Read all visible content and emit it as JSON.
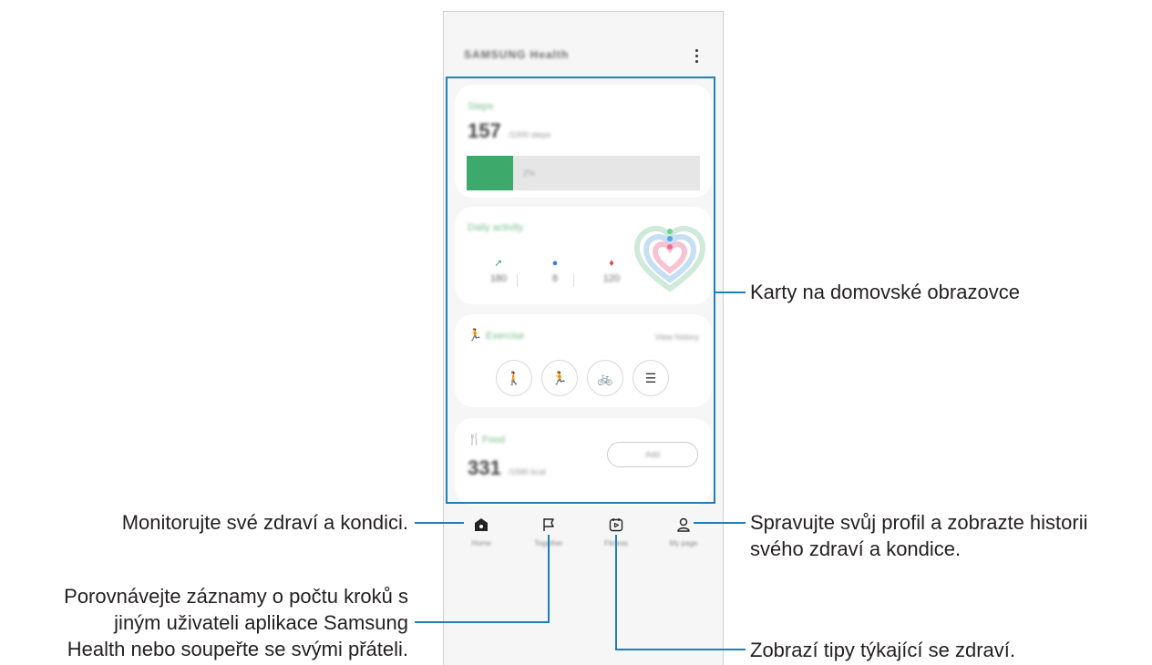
{
  "app": {
    "title": "SAMSUNG Health",
    "menu_icon": "more-vertical-icon"
  },
  "cards": {
    "steps": {
      "label": "Steps",
      "value": "157",
      "goal": "/1000 steps",
      "bar_label": "2%",
      "progress_fraction": 0.2
    },
    "daily_activity": {
      "label": "Daily activity",
      "metrics": [
        {
          "icon": "shoe-icon",
          "color": "#3daa6c",
          "value": "180"
        },
        {
          "icon": "clock-icon",
          "color": "#3b7fd9",
          "value": "8"
        },
        {
          "icon": "flame-icon",
          "color": "#e8474d",
          "value": "120"
        }
      ]
    },
    "exercise": {
      "label": "Exercise",
      "link": "View history",
      "buttons": [
        {
          "icon": "walking-icon",
          "glyph": "🚶"
        },
        {
          "icon": "running-icon",
          "glyph": "🏃"
        },
        {
          "icon": "cycling-icon",
          "glyph": "🚲"
        },
        {
          "icon": "list-icon",
          "glyph": "☰"
        }
      ]
    },
    "food": {
      "label": "Food",
      "value": "331",
      "unit": "/1580 kcal",
      "button": "Add"
    }
  },
  "bottom_nav": [
    {
      "label": "Home",
      "icon": "home-icon"
    },
    {
      "label": "Together",
      "icon": "flag-icon"
    },
    {
      "label": "Fitness",
      "icon": "play-calendar-icon"
    },
    {
      "label": "My page",
      "icon": "person-icon"
    }
  ],
  "callouts": {
    "cards": "Karty na domovské obrazovce",
    "home": "Monitorujte své zdraví a kondici.",
    "together": [
      "Porovnávejte záznamy o počtu kroků s",
      "jiným uživateli aplikace Samsung",
      "Health nebo soupeřte se svými přáteli."
    ],
    "fitness": "Zobrazí tipy týkající se zdraví.",
    "profile": [
      "Spravujte svůj profil a zobrazte historii",
      "svého zdraví a kondice."
    ]
  },
  "colors": {
    "accent_line": "#1f7fb8",
    "steps_green": "#3daa6c"
  }
}
